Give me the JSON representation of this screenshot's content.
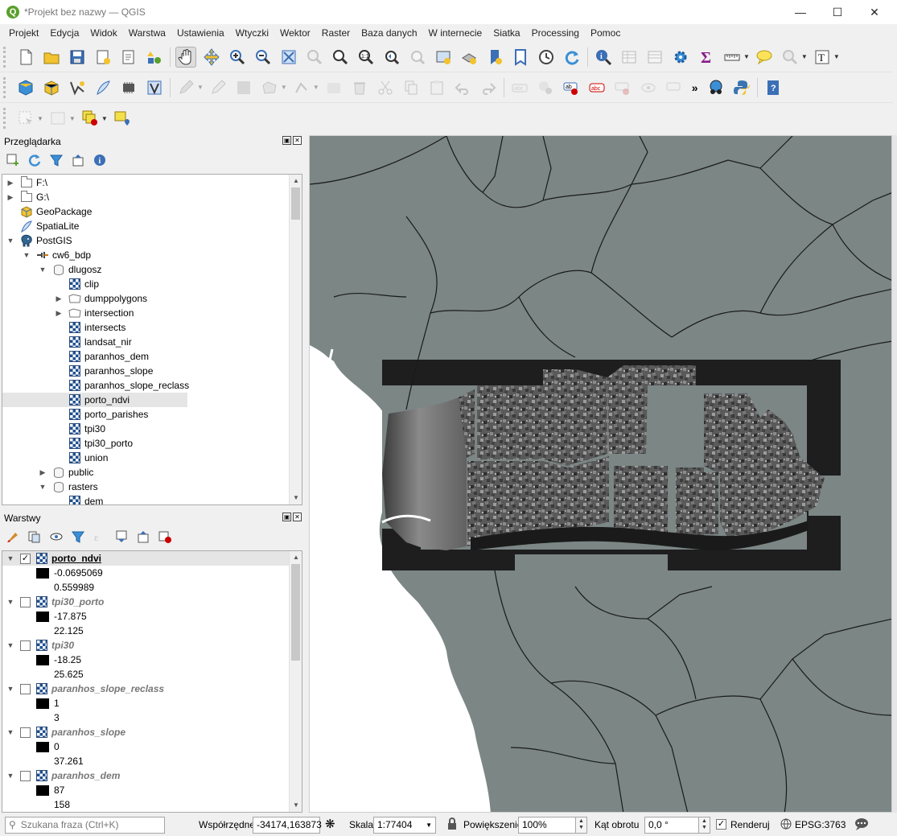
{
  "window": {
    "title": "*Projekt bez nazwy — QGIS"
  },
  "menu": [
    "Projekt",
    "Edycja",
    "Widok",
    "Warstwa",
    "Ustawienia",
    "Wtyczki",
    "Wektor",
    "Raster",
    "Baza danych",
    "W internecie",
    "Siatka",
    "Processing",
    "Pomoc"
  ],
  "browser": {
    "title": "Przeglądarka",
    "items": [
      {
        "label": "F:\\",
        "icon": "folder-icon",
        "arrow": "right",
        "indent": 0
      },
      {
        "label": "G:\\",
        "icon": "folder-icon",
        "arrow": "right",
        "indent": 0
      },
      {
        "label": "GeoPackage",
        "icon": "geopackage-icon",
        "arrow": "",
        "indent": 0
      },
      {
        "label": "SpatiaLite",
        "icon": "spatialite-icon",
        "arrow": "",
        "indent": 0
      },
      {
        "label": "PostGIS",
        "icon": "postgis-elephant-icon",
        "arrow": "down",
        "indent": 0
      },
      {
        "label": "cw6_bdp",
        "icon": "connection-icon",
        "arrow": "down",
        "indent": 1
      },
      {
        "label": "dlugosz",
        "icon": "schema-db-icon",
        "arrow": "down",
        "indent": 2
      },
      {
        "label": "clip",
        "icon": "raster-layer-icon",
        "arrow": "",
        "indent": 3
      },
      {
        "label": "dumppolygons",
        "icon": "polygon-layer-icon",
        "arrow": "right",
        "indent": 3
      },
      {
        "label": "intersection",
        "icon": "polygon-layer-icon",
        "arrow": "right",
        "indent": 3
      },
      {
        "label": "intersects",
        "icon": "raster-layer-icon",
        "arrow": "",
        "indent": 3
      },
      {
        "label": "landsat_nir",
        "icon": "raster-layer-icon",
        "arrow": "",
        "indent": 3
      },
      {
        "label": "paranhos_dem",
        "icon": "raster-layer-icon",
        "arrow": "",
        "indent": 3
      },
      {
        "label": "paranhos_slope",
        "icon": "raster-layer-icon",
        "arrow": "",
        "indent": 3
      },
      {
        "label": "paranhos_slope_reclass",
        "icon": "raster-layer-icon",
        "arrow": "",
        "indent": 3
      },
      {
        "label": "porto_ndvi",
        "icon": "raster-layer-icon",
        "arrow": "",
        "indent": 3,
        "selected": true
      },
      {
        "label": "porto_parishes",
        "icon": "raster-layer-icon",
        "arrow": "",
        "indent": 3
      },
      {
        "label": "tpi30",
        "icon": "raster-layer-icon",
        "arrow": "",
        "indent": 3
      },
      {
        "label": "tpi30_porto",
        "icon": "raster-layer-icon",
        "arrow": "",
        "indent": 3
      },
      {
        "label": "union",
        "icon": "raster-layer-icon",
        "arrow": "",
        "indent": 3
      },
      {
        "label": "public",
        "icon": "schema-db-icon",
        "arrow": "right",
        "indent": 2
      },
      {
        "label": "rasters",
        "icon": "schema-db-icon",
        "arrow": "down",
        "indent": 2
      },
      {
        "label": "dem",
        "icon": "raster-layer-icon",
        "arrow": "",
        "indent": 3
      }
    ]
  },
  "layers": {
    "title": "Warstwy",
    "items": [
      {
        "name": "porto_ndvi",
        "checked": true,
        "min": "-0.0695069",
        "max": "0.559989",
        "active": true
      },
      {
        "name": "tpi30_porto",
        "checked": false,
        "min": "-17.875",
        "max": "22.125"
      },
      {
        "name": "tpi30",
        "checked": false,
        "min": "-18.25",
        "max": "25.625"
      },
      {
        "name": "paranhos_slope_reclass",
        "checked": false,
        "min": "1",
        "max": "3"
      },
      {
        "name": "paranhos_slope",
        "checked": false,
        "min": "0",
        "max": "37.261"
      },
      {
        "name": "paranhos_dem",
        "checked": false,
        "min": "87",
        "max": "158"
      }
    ]
  },
  "status": {
    "search_placeholder": "Szukana fraza (Ctrl+K)",
    "coord_label": "Współrzędne",
    "coord_value": "-34174,163873",
    "scale_label": "Skala",
    "scale_value": "1:77404",
    "zoom_label": "Powiększenie",
    "zoom_value": "100%",
    "rotation_label": "Kąt obrotu",
    "rotation_value": "0,0 °",
    "render_label": "Renderuj",
    "render_checked": true,
    "crs": "EPSG:3763"
  },
  "colors": {
    "map_land": "#7b8685",
    "map_water": "#ffffff",
    "raster_frame": "#1e1e1e",
    "accent": "#1f4f8f"
  }
}
